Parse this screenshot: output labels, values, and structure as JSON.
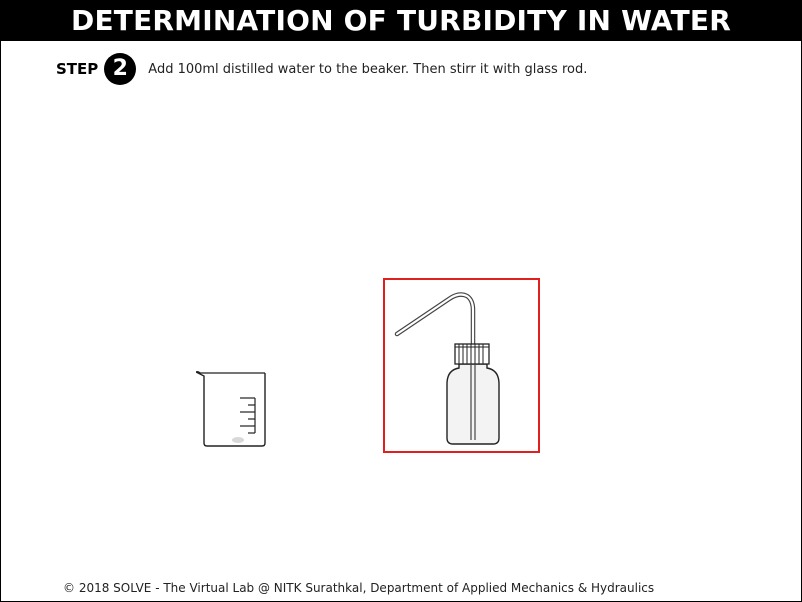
{
  "header": {
    "title": "DETERMINATION OF TURBIDITY IN WATER"
  },
  "step": {
    "label": "STEP",
    "number": "2",
    "instruction": "Add 100ml distilled water to the beaker. Then stirr it with glass rod."
  },
  "apparatus": {
    "beaker_icon": "beaker-icon",
    "wash_bottle_icon": "wash-bottle-icon",
    "highlight_color": "#e0201f"
  },
  "footer": {
    "text": "© 2018 SOLVE - The Virtual Lab @ NITK Surathkal, Department of Applied Mechanics & Hydraulics"
  }
}
